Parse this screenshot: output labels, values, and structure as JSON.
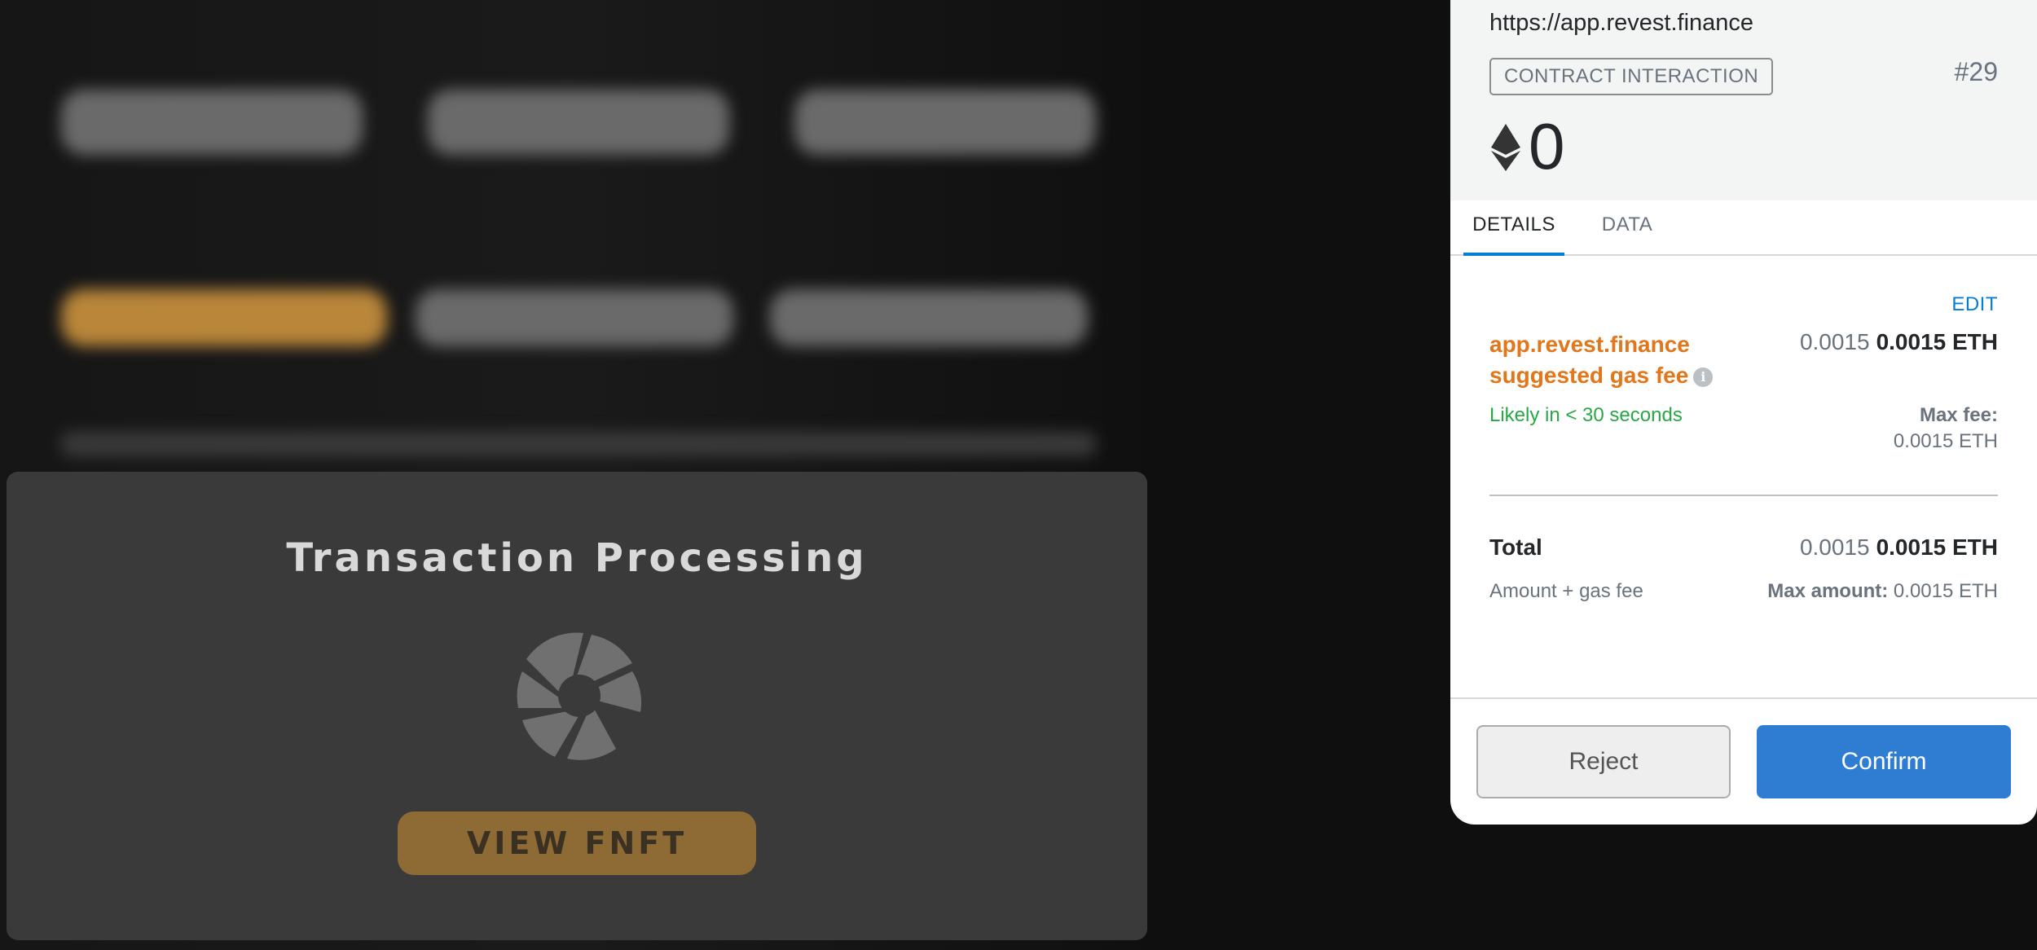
{
  "modal": {
    "title": "Transaction Processing",
    "view_button": "VIEW FNFT"
  },
  "popup": {
    "origin": "https://app.revest.finance",
    "badge": "CONTRACT INTERACTION",
    "nonce": "#29",
    "amount": "0",
    "tabs": [
      {
        "label": "DETAILS",
        "active": true
      },
      {
        "label": "DATA",
        "active": false
      }
    ],
    "edit": "EDIT",
    "gas_label_line1": "app.revest.finance",
    "gas_label_line2": "suggested gas fee",
    "gas_amount_light": "0.0015",
    "gas_amount_bold": "0.0015 ETH",
    "likely": "Likely in < 30 seconds",
    "max_fee_label": "Max fee:",
    "max_fee_value": "0.0015 ETH",
    "total_label": "Total",
    "total_amount_light": "0.0015",
    "total_amount_bold": "0.0015 ETH",
    "subtotal_label": "Amount + gas fee",
    "max_amount_label": "Max amount:",
    "max_amount_value": "0.0015 ETH",
    "reject": "Reject",
    "confirm": "Confirm"
  },
  "colors": {
    "accent_blue": "#037dd6",
    "confirm_blue": "#2f7cd3",
    "gas_orange": "#e2761b",
    "likely_green": "#28a745",
    "gold_button": "#8e6a35"
  },
  "icons": [
    "ethereum-icon",
    "info-icon",
    "loading-spinner-icon"
  ]
}
